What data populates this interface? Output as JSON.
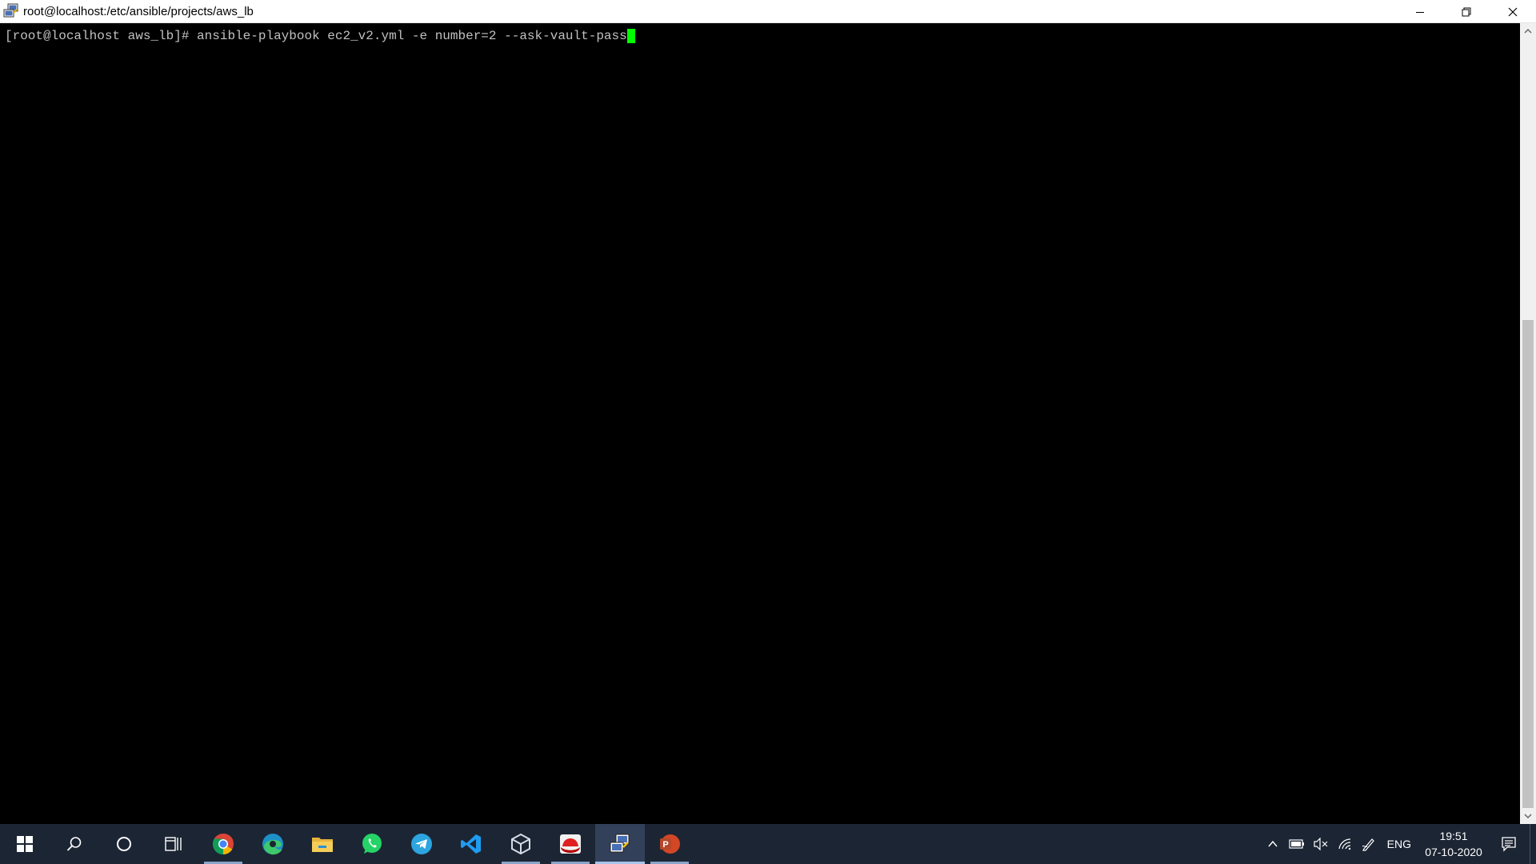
{
  "window": {
    "title": "root@localhost:/etc/ansible/projects/aws_lb",
    "icon": "putty-icon",
    "controls": [
      "minimize-icon",
      "restore-icon",
      "close-icon"
    ]
  },
  "terminal": {
    "prompt": "[root@localhost aws_lb]# ",
    "command": "ansible-playbook ec2_v2.yml -e number=2 --ask-vault-pass",
    "text_color": "#c0c0c0",
    "cursor_color": "#00ff00",
    "background": "#000000"
  },
  "taskbar": {
    "start": "windows-start-icon",
    "search": "search-icon",
    "cortana": "cortana-icon",
    "task_view": "task-view-icon",
    "apps": [
      {
        "name": "chrome-icon",
        "running": true
      },
      {
        "name": "edge-icon",
        "running": false
      },
      {
        "name": "file-explorer-icon",
        "running": false
      },
      {
        "name": "whatsapp-icon",
        "running": false
      },
      {
        "name": "telegram-icon",
        "running": false
      },
      {
        "name": "vscode-icon",
        "running": false
      },
      {
        "name": "virtualbox-icon",
        "running": true
      },
      {
        "name": "redhat-icon",
        "running": true
      },
      {
        "name": "putty-icon",
        "running": true,
        "active": true
      },
      {
        "name": "powerpoint-icon",
        "running": true
      }
    ],
    "tray": {
      "icons": [
        "chevron-up-icon",
        "battery-icon",
        "volume-muted-icon",
        "wifi-icon",
        "pen-icon"
      ],
      "language": "ENG",
      "time": "19:51",
      "date": "07-10-2020",
      "notification": "notification-icon"
    }
  }
}
